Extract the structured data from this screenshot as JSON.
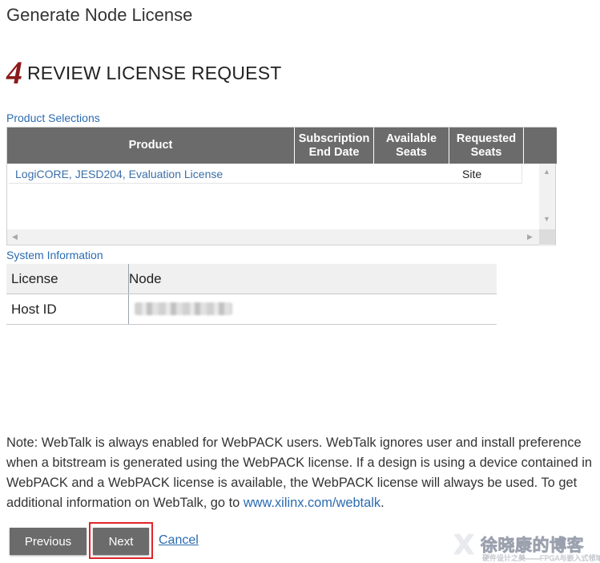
{
  "page": {
    "title": "Generate Node License"
  },
  "step": {
    "number": "4",
    "title": "REVIEW LICENSE REQUEST"
  },
  "product_selections": {
    "label": "Product Selections",
    "columns": [
      "Product",
      "Subscription End Date",
      "Available Seats",
      "Requested Seats"
    ],
    "rows": [
      {
        "product": "LogiCORE, JESD204, Evaluation License",
        "subscription_end_date": "",
        "available_seats": "",
        "requested_seats": "Site"
      }
    ]
  },
  "system_information": {
    "label": "System Information",
    "rows": [
      {
        "key": "License",
        "value": "Node"
      },
      {
        "key": "Host ID",
        "value": ""
      }
    ]
  },
  "note": {
    "text": "Note: WebTalk is always enabled for WebPACK users. WebTalk ignores user and install preference when a bitstream is generated using the WebPACK license. If a design is using a device contained in WebPACK and a WebPACK license is available, the WebPACK license will always be used. To get additional information on WebTalk, go to ",
    "link_text": "www.xilinx.com/webtalk",
    "suffix": "."
  },
  "buttons": {
    "previous": "Previous",
    "next": "Next",
    "cancel": "Cancel"
  },
  "watermark": {
    "title": "徐晓康的博客",
    "subtitle": "硬件设计之美——FPGA与嵌入式领域分享"
  },
  "colors": {
    "accent_link": "#2a6bb1",
    "header_gray": "#6b6b6b",
    "step_number": "#8b1a1a",
    "highlight": "#e0252b"
  }
}
